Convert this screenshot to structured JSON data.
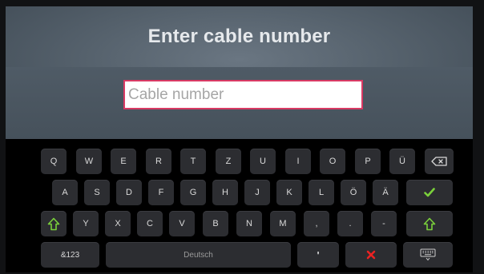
{
  "header": {
    "title": "Enter cable number"
  },
  "input": {
    "placeholder": "Cable number",
    "value": ""
  },
  "keyboard": {
    "row1": [
      "Q",
      "W",
      "E",
      "R",
      "T",
      "Z",
      "U",
      "I",
      "O",
      "P",
      "Ü"
    ],
    "row2": [
      "A",
      "S",
      "D",
      "F",
      "G",
      "H",
      "J",
      "K",
      "L",
      "Ö",
      "Ä"
    ],
    "row3": [
      "Y",
      "X",
      "C",
      "V",
      "B",
      "N",
      "M",
      ",",
      ".",
      "-"
    ],
    "symbols_label": "&123",
    "space_label": "Deutsch",
    "apostrophe_label": "'",
    "icons": {
      "backspace": "backspace-icon",
      "confirm": "checkmark-icon",
      "shift": "shift-arrow-icon",
      "cancel": "x-icon",
      "hide": "keyboard-hide-icon"
    },
    "colors": {
      "confirm": "#7ad03b",
      "shift": "#7ad03b",
      "cancel": "#ea2222",
      "input_border": "#d93a64"
    }
  }
}
